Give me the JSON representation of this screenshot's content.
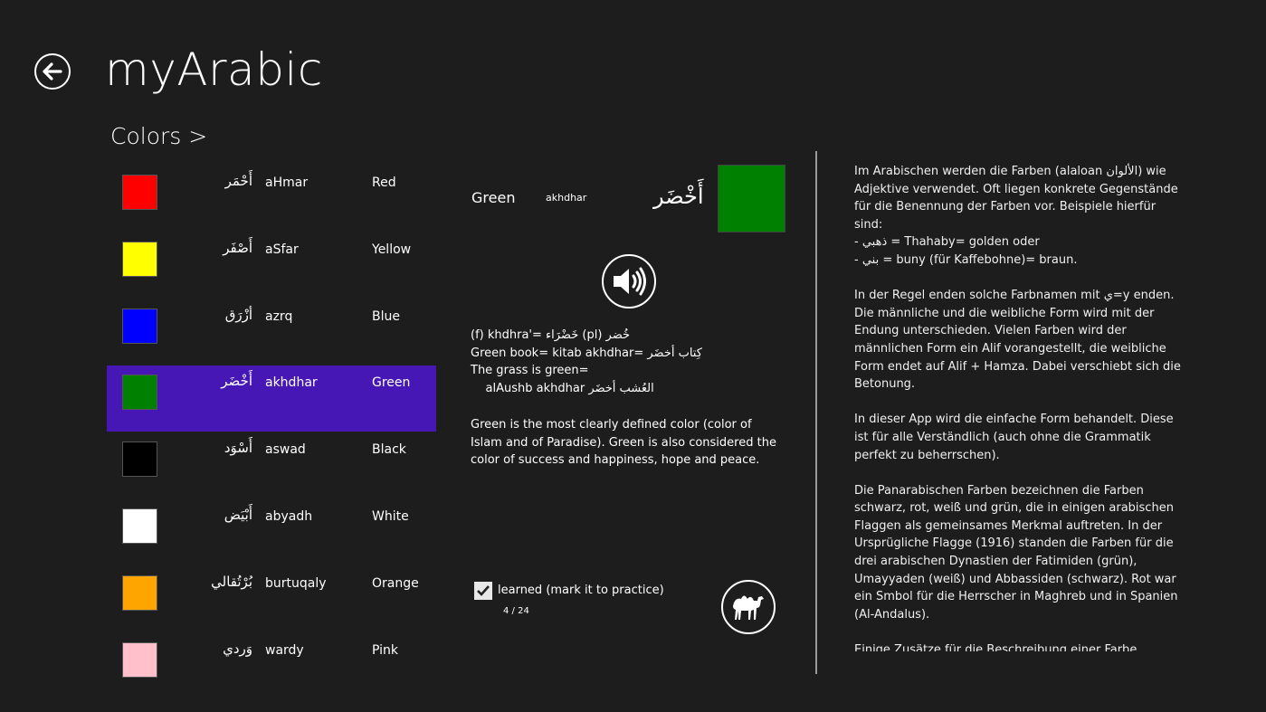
{
  "app": {
    "title": "myArabic"
  },
  "section": {
    "title": "Colors >"
  },
  "colors": [
    {
      "arabic": "أَحْمَر",
      "translit": "aHmar",
      "english": "Red",
      "swatch": "#ff0000"
    },
    {
      "arabic": "أَصْفَر",
      "translit": "aSfar",
      "english": "Yellow",
      "swatch": "#ffff00"
    },
    {
      "arabic": "أزْرَق",
      "translit": "azrq",
      "english": "Blue",
      "swatch": "#0000ff"
    },
    {
      "arabic": "أَخْضَر",
      "translit": "akhdhar",
      "english": "Green",
      "swatch": "#008000"
    },
    {
      "arabic": "أَسْوَد",
      "translit": "aswad",
      "english": "Black",
      "swatch": "#000000"
    },
    {
      "arabic": "أَبْيَض",
      "translit": "abyadh",
      "english": "White",
      "swatch": "#ffffff"
    },
    {
      "arabic": "بُرْتُقالي",
      "translit": "burtuqaly",
      "english": "Orange",
      "swatch": "#ffa500"
    },
    {
      "arabic": "وَردي",
      "translit": "wardy",
      "english": "Pink",
      "swatch": "#ffc0cb"
    }
  ],
  "selected_index": 3,
  "detail": {
    "english": "Green",
    "translit": "akhdhar",
    "arabic": "أَخْضَر",
    "swatch": "#008000",
    "examples": [
      "(f) khdhra'= خَضْرَاء          (pl) خُضر",
      "Green book= kitab akhdhar= كِتاب أخضَر",
      "The grass is green=",
      "    alAushb akhdhar العُشب أخضَر"
    ],
    "description": "Green is the most clearly defined color (color of Islam and of Paradise). Green is also considered the color of success and happiness, hope and peace.",
    "learned_label": "learned (mark it to practice)",
    "learned": true,
    "counter": "4 / 24"
  },
  "info": {
    "paragraphs": [
      "Im Arabischen werden die Farben  (alaloan الألوان)  wie Adjektive verwendet. Oft liegen konkrete Gegenstände für die Benennung der Farben vor. Beispiele hierfür sind:\n-   ذهبي = Thahaby= golden oder\n-   بني   = buny (für Kaffebohne)= braun.",
      "In der Regel enden solche Farbnamen mit ي=y enden. Die männliche und die weibliche Form wird mit der Endung unterschieden. Vielen Farben wird der männlichen Form ein Alif vorangestellt, die weibliche Form endet auf Alif + Hamza. Dabei verschiebt sich die Betonung.",
      "In dieser App wird die einfache Form behandelt. Diese ist für alle Verständlich (auch ohne die Grammatik perfekt zu beherrschen).",
      "Die Panarabischen Farben bezeichnen die Farben schwarz, rot, weiß und grün, die in einigen arabischen Flaggen als gemeinsames Merkmal auftreten. In der Ursprügliche Flagge (1916) standen die Farben für die drei arabischen Dynastien der Fatimiden (grün), Umayyaden (weiß) und Abbassiden (schwarz). Rot war ein Smbol für die Herrscher in Maghreb und in Spanien (Al-Andalus).",
      "Einige Zusätze für die Beschreibung einer Farbe könnten auch wie an anderen Sprache verwendet werden:\n-  Hell            = fateH    = فاتح"
    ]
  }
}
